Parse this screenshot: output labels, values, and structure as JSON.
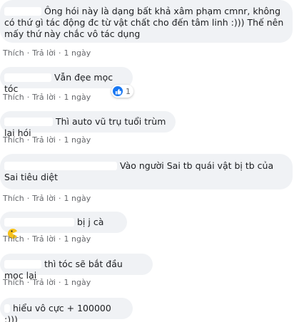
{
  "action_like": "Thích",
  "action_reply": "Trả lời",
  "comments": [
    {
      "text": "Ông hói này là dạng bất khả xâm phạm cmnr, không có thứ gì tác động đc từ vật chất cho đến tâm linh :))) Thế nên mấy thứ này chắc vô tác dụng",
      "time": "1 ngày"
    },
    {
      "text": "Vẫn đẹe mọc tóc",
      "time": "1 ngày",
      "reaction_count": "1"
    },
    {
      "text": "Thì auto vũ trụ tuổi trùm lại hói",
      "time": "1 ngày"
    },
    {
      "text": "Vào người Sai tb quái vật bị tb của Sai tiêu diệt",
      "time": "1 ngày"
    },
    {
      "text": "bị j cà",
      "time": "1 ngày",
      "emoji": "pacman-emoji"
    },
    {
      "text": "thì tóc sẽ bắt đầu mọc lại",
      "time": "1 ngày"
    },
    {
      "text": "hiểu vô cực + 100000 :)))"
    }
  ],
  "colors": {
    "bubble_bg": "#f0f2f5",
    "meta_text": "#65676b",
    "like_blue": "#1877f2"
  }
}
